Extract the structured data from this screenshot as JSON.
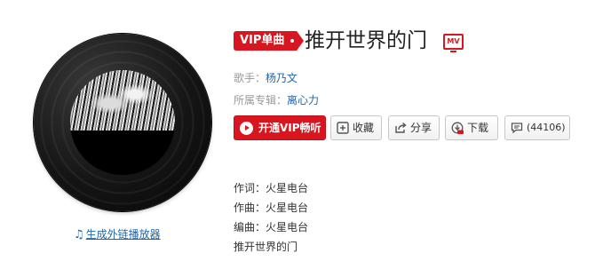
{
  "badge": {
    "label": "VIP单曲"
  },
  "song": {
    "title": "推开世界的门",
    "mv_icon_label": "MV"
  },
  "info": {
    "singer_label": "歌手：",
    "singer": "杨乃文",
    "album_label": "所属专辑：",
    "album": "离心力"
  },
  "actions": {
    "vip_play": "开通VIP畅听",
    "collect": "收藏",
    "share": "分享",
    "download": "下载",
    "comments": "(44106)"
  },
  "credits": [
    "作词：火星电台",
    "作曲：火星电台",
    "编曲：火星电台",
    "推开世界的门"
  ],
  "player_link": "生成外链播放器",
  "icons": {
    "play": "play-circle-icon",
    "collect": "plus-box-icon",
    "share": "share-arrow-icon",
    "download": "download-cloud-vip-icon",
    "comments": "comment-bubble-icon",
    "player": "music-note-icon",
    "mv": "mv-tv-icon"
  },
  "colors": {
    "accent_red": "#d8161f",
    "link_blue": "#2266aa",
    "muted_text": "#999999"
  }
}
